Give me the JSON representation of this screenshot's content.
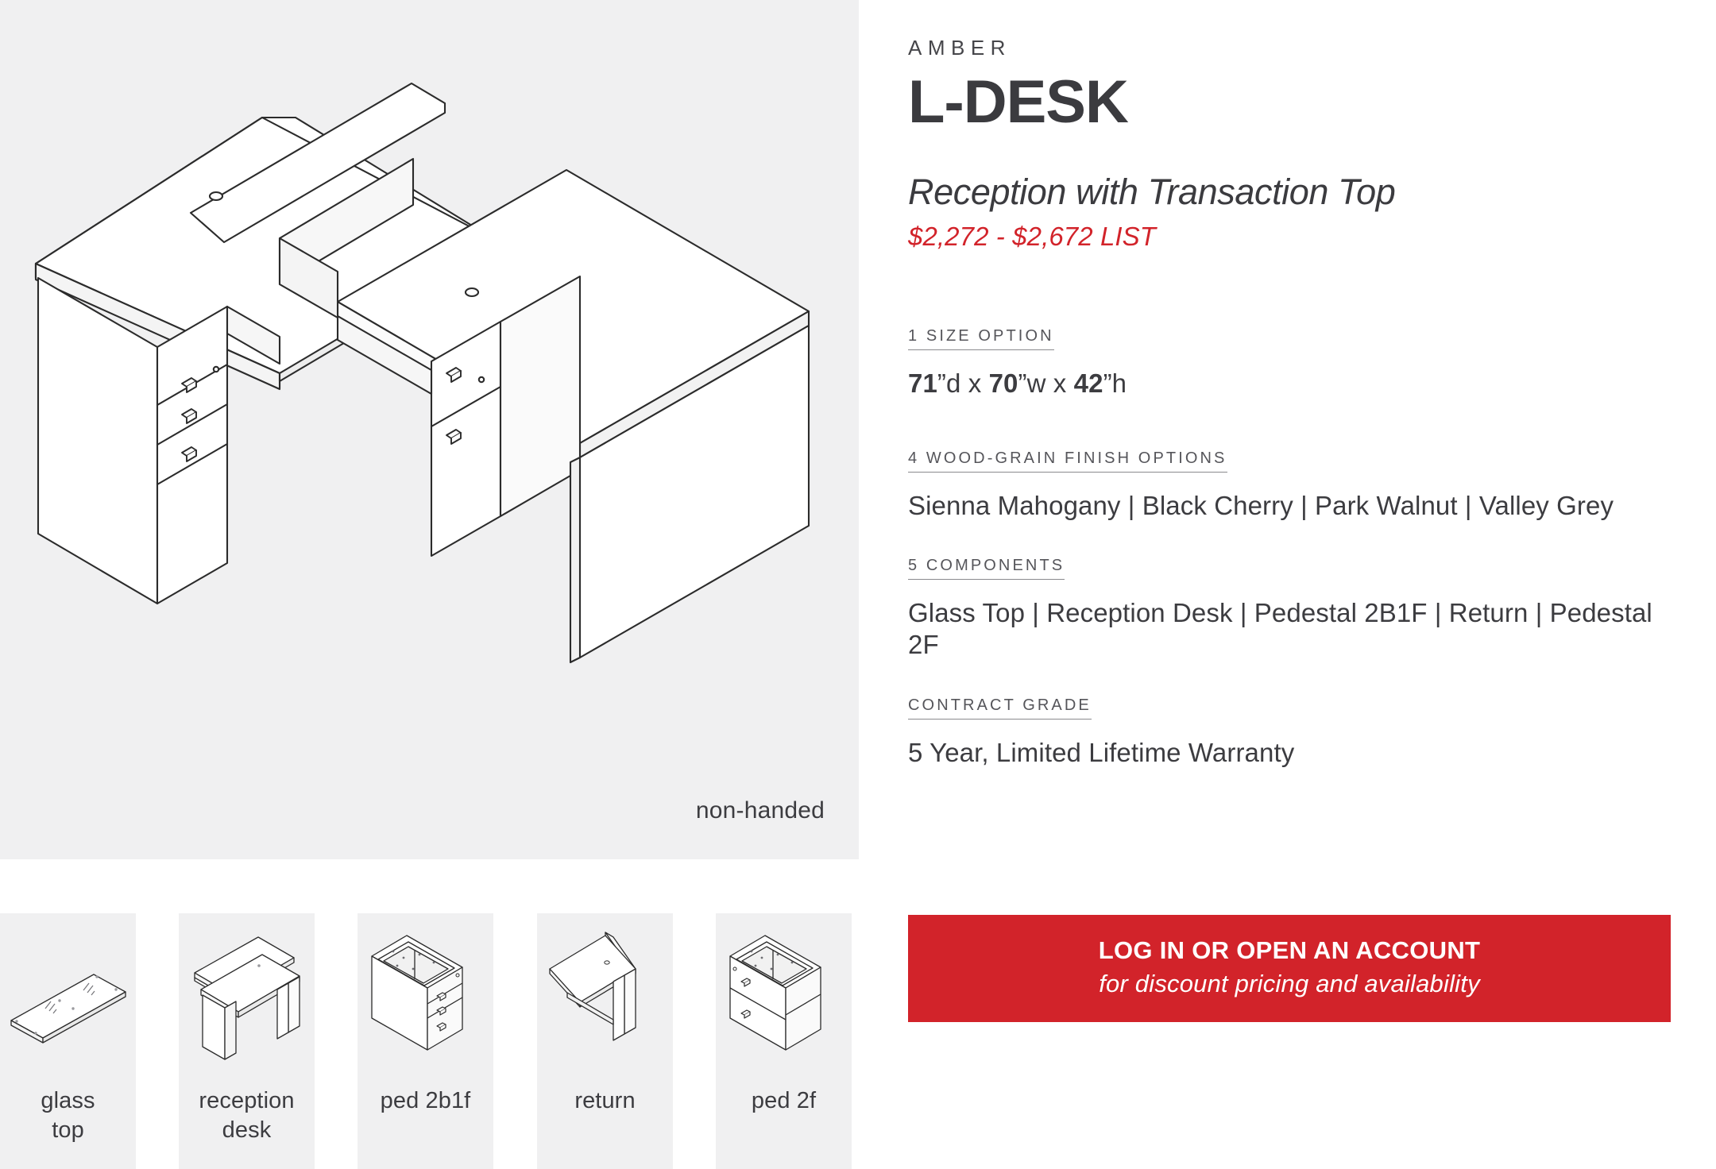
{
  "hero": {
    "caption": "non-handed",
    "background_color": "#f0f0f1",
    "line_color": "#2b2b2b"
  },
  "info": {
    "brand": "AMBER",
    "title": "L-DESK",
    "subtitle": "Reception with Transaction Top",
    "price": "$2,272 - $2,672 LIST",
    "price_color": "#d2232a"
  },
  "specs": [
    {
      "label": "1 SIZE OPTION",
      "value_parts": [
        {
          "text": "71",
          "bold": true
        },
        {
          "text": "”d x ",
          "bold": false
        },
        {
          "text": "70",
          "bold": true
        },
        {
          "text": "”w x ",
          "bold": false
        },
        {
          "text": "42",
          "bold": true
        },
        {
          "text": "”h",
          "bold": false
        }
      ]
    },
    {
      "label": "4 WOOD-GRAIN FINISH OPTIONS",
      "value": "Sienna Mahogany | Black Cherry | Park Walnut | Valley Grey"
    },
    {
      "label": "5 COMPONENTS",
      "value": "Glass Top | Reception Desk | Pedestal 2B1F | Return | Pedestal 2F"
    },
    {
      "label": "CONTRACT GRADE",
      "value": "5 Year, Limited Lifetime Warranty"
    }
  ],
  "spec_labels": {
    "size": "1 SIZE OPTION",
    "finish": "4 WOOD-GRAIN FINISH OPTIONS",
    "components": "5 COMPONENTS",
    "contract": "CONTRACT GRADE"
  },
  "spec_values": {
    "size_dim1": "71",
    "size_suffix1": "”d x ",
    "size_dim2": "70",
    "size_suffix2": "”w x ",
    "size_dim3": "42",
    "size_suffix3": "”h",
    "finish": "Sienna Mahogany | Black Cherry | Park Walnut | Valley Grey",
    "components": "Glass Top | Reception Desk | Pedestal 2B1F | Return | Pedestal 2F",
    "contract": "5 Year, Limited Lifetime Warranty"
  },
  "thumbnails": [
    {
      "label": "glass\ntop",
      "label_line1": "glass",
      "label_line2": "top",
      "icon": "glass-top-icon"
    },
    {
      "label": "reception\ndesk",
      "label_line1": "reception",
      "label_line2": "desk",
      "icon": "reception-desk-icon"
    },
    {
      "label": "ped 2b1f",
      "label_line1": "ped 2b1f",
      "label_line2": "",
      "icon": "pedestal-2b1f-icon"
    },
    {
      "label": "return",
      "label_line1": "return",
      "label_line2": "",
      "icon": "return-icon"
    },
    {
      "label": "ped 2f",
      "label_line1": "ped 2f",
      "label_line2": "",
      "icon": "pedestal-2f-icon"
    }
  ],
  "cta": {
    "primary": "LOG IN OR OPEN AN ACCOUNT",
    "secondary": "for discount pricing and availability",
    "background_color": "#d2232a"
  }
}
